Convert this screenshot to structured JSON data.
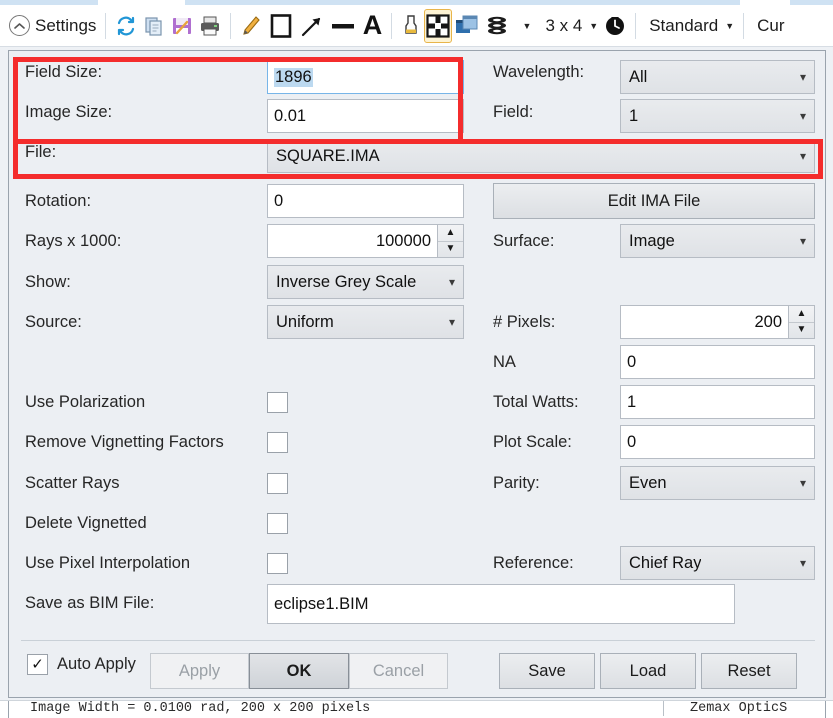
{
  "toolbar": {
    "settings_label": "Settings",
    "items": [
      {
        "name": "collapse-settings-icon",
        "glyph": "∧"
      },
      {
        "name": "refresh-icon"
      },
      {
        "name": "copy-icon"
      },
      {
        "name": "save-icon"
      },
      {
        "name": "print-icon"
      },
      {
        "name": "pencil-icon"
      },
      {
        "name": "rectangle-icon"
      },
      {
        "name": "arrow-icon"
      },
      {
        "name": "line-icon"
      },
      {
        "name": "text-icon",
        "glyph": "A"
      },
      {
        "name": "color-icon"
      },
      {
        "name": "grid-icon"
      },
      {
        "name": "windows-icon"
      },
      {
        "name": "layers-icon"
      }
    ],
    "grid_size_label": "3 x 4",
    "clock_icon": "clock-icon",
    "style_label": "Standard",
    "current_label": "Cur"
  },
  "dialog": {
    "fields": {
      "field_size": {
        "label": "Field Size:",
        "value": "1896",
        "selected": true
      },
      "image_size": {
        "label": "Image Size:",
        "value": "0.01"
      },
      "file": {
        "label": "File:",
        "value": "SQUARE.IMA"
      },
      "rotation": {
        "label": "Rotation:",
        "value": "0"
      },
      "rays": {
        "label": "Rays x 1000:",
        "value": "100000"
      },
      "show": {
        "label": "Show:",
        "value": "Inverse Grey Scale"
      },
      "source": {
        "label": "Source:",
        "value": "Uniform"
      },
      "wavelength": {
        "label": "Wavelength:",
        "value": "All"
      },
      "field": {
        "label": "Field:",
        "value": "1"
      },
      "edit_ima": {
        "label": "Edit IMA File"
      },
      "surface": {
        "label": "Surface:",
        "value": "Image"
      },
      "pixels": {
        "label": "# Pixels:",
        "value": "200"
      },
      "na": {
        "label": "NA",
        "value": "0"
      },
      "total_watts": {
        "label": "Total Watts:",
        "value": "1"
      },
      "plot_scale": {
        "label": "Plot Scale:",
        "value": "0"
      },
      "parity": {
        "label": "Parity:",
        "value": "Even"
      },
      "reference": {
        "label": "Reference:",
        "value": "Chief Ray"
      },
      "save_bim": {
        "label": "Save as BIM File:",
        "value": "eclipse1.BIM"
      }
    },
    "checkboxes": [
      {
        "label": "Use Polarization",
        "checked": false
      },
      {
        "label": "Remove Vignetting Factors",
        "checked": false
      },
      {
        "label": "Scatter Rays",
        "checked": false
      },
      {
        "label": "Delete Vignetted",
        "checked": false
      },
      {
        "label": "Use Pixel Interpolation",
        "checked": false
      }
    ],
    "footer": {
      "auto_apply_label": "Auto Apply",
      "auto_apply_checked": true,
      "apply_label": "Apply",
      "apply_disabled": true,
      "ok_label": "OK",
      "cancel_label": "Cancel",
      "cancel_disabled": true,
      "save_label": "Save",
      "load_label": "Load",
      "reset_label": "Reset"
    }
  },
  "annotations": {
    "highlight_color": "#f42c2c",
    "boxes": [
      {
        "name": "field-size-image-size-highlight"
      },
      {
        "name": "file-row-highlight"
      }
    ]
  },
  "statusbar": {
    "left_text": "Image Width = 0.0100 rad, 200 x 200 pixels",
    "right_text": "Zemax OpticS"
  }
}
